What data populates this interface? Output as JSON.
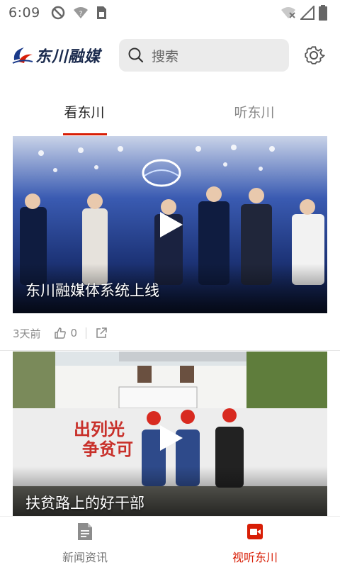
{
  "status_bar": {
    "time": "6:09",
    "left_icons": [
      "sync-off-icon",
      "wifi-question-icon",
      "sim-card-icon"
    ],
    "right_icons": [
      "wifi-off-icon",
      "cell-signal-icon",
      "battery-icon"
    ]
  },
  "header": {
    "logo_text": "东川融媒",
    "search_placeholder": "搜索",
    "icons": [
      "logo-icon",
      "search-icon",
      "gear-icon"
    ]
  },
  "tabs": [
    {
      "label": "看东川",
      "active": true
    },
    {
      "label": "听东川",
      "active": false
    }
  ],
  "videos": [
    {
      "title": "东川融媒体系统上线",
      "time_ago": "3天前",
      "likes": "0",
      "icons": [
        "play-icon",
        "thumbs-up-icon",
        "share-icon"
      ]
    },
    {
      "title": "扶贫路上的好干部",
      "icons": [
        "play-icon"
      ]
    }
  ],
  "bottom_nav": [
    {
      "label": "新闻资讯",
      "icon": "document-icon",
      "active": false
    },
    {
      "label": "视听东川",
      "icon": "video-camera-icon",
      "active": true
    }
  ],
  "colors": {
    "accent": "#d81e06",
    "inactive_text": "#888888",
    "search_bg": "#ebebeb"
  }
}
